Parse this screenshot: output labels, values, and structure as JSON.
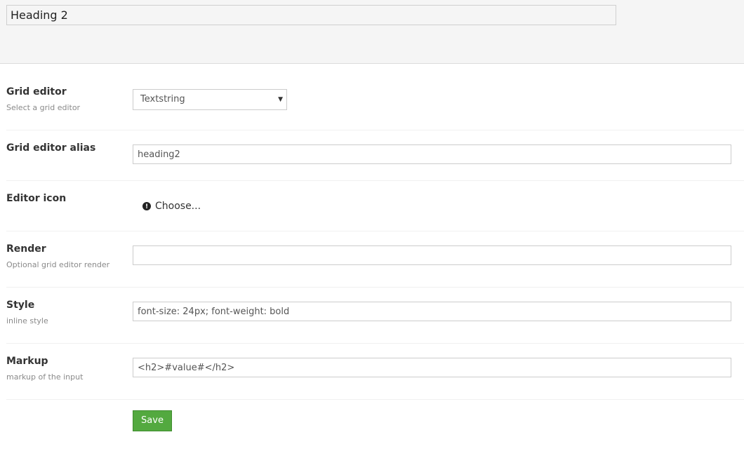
{
  "header": {
    "name_value": "Heading 2"
  },
  "form": {
    "grid_editor": {
      "label": "Grid editor",
      "description": "Select a grid editor",
      "selected": "Textstring"
    },
    "grid_editor_alias": {
      "label": "Grid editor alias",
      "value": "heading2"
    },
    "editor_icon": {
      "label": "Editor icon",
      "choose_label": "Choose...",
      "icon": "info-icon"
    },
    "render": {
      "label": "Render",
      "description": "Optional grid editor render",
      "value": ""
    },
    "style": {
      "label": "Style",
      "description": "inline style",
      "value": "font-size: 24px; font-weight: bold"
    },
    "markup": {
      "label": "Markup",
      "description": "markup of the input",
      "value": "<h2>#value#</h2>"
    }
  },
  "actions": {
    "save_label": "Save"
  },
  "colors": {
    "save_button": "#53a93f",
    "header_bg": "#f5f5f5"
  }
}
